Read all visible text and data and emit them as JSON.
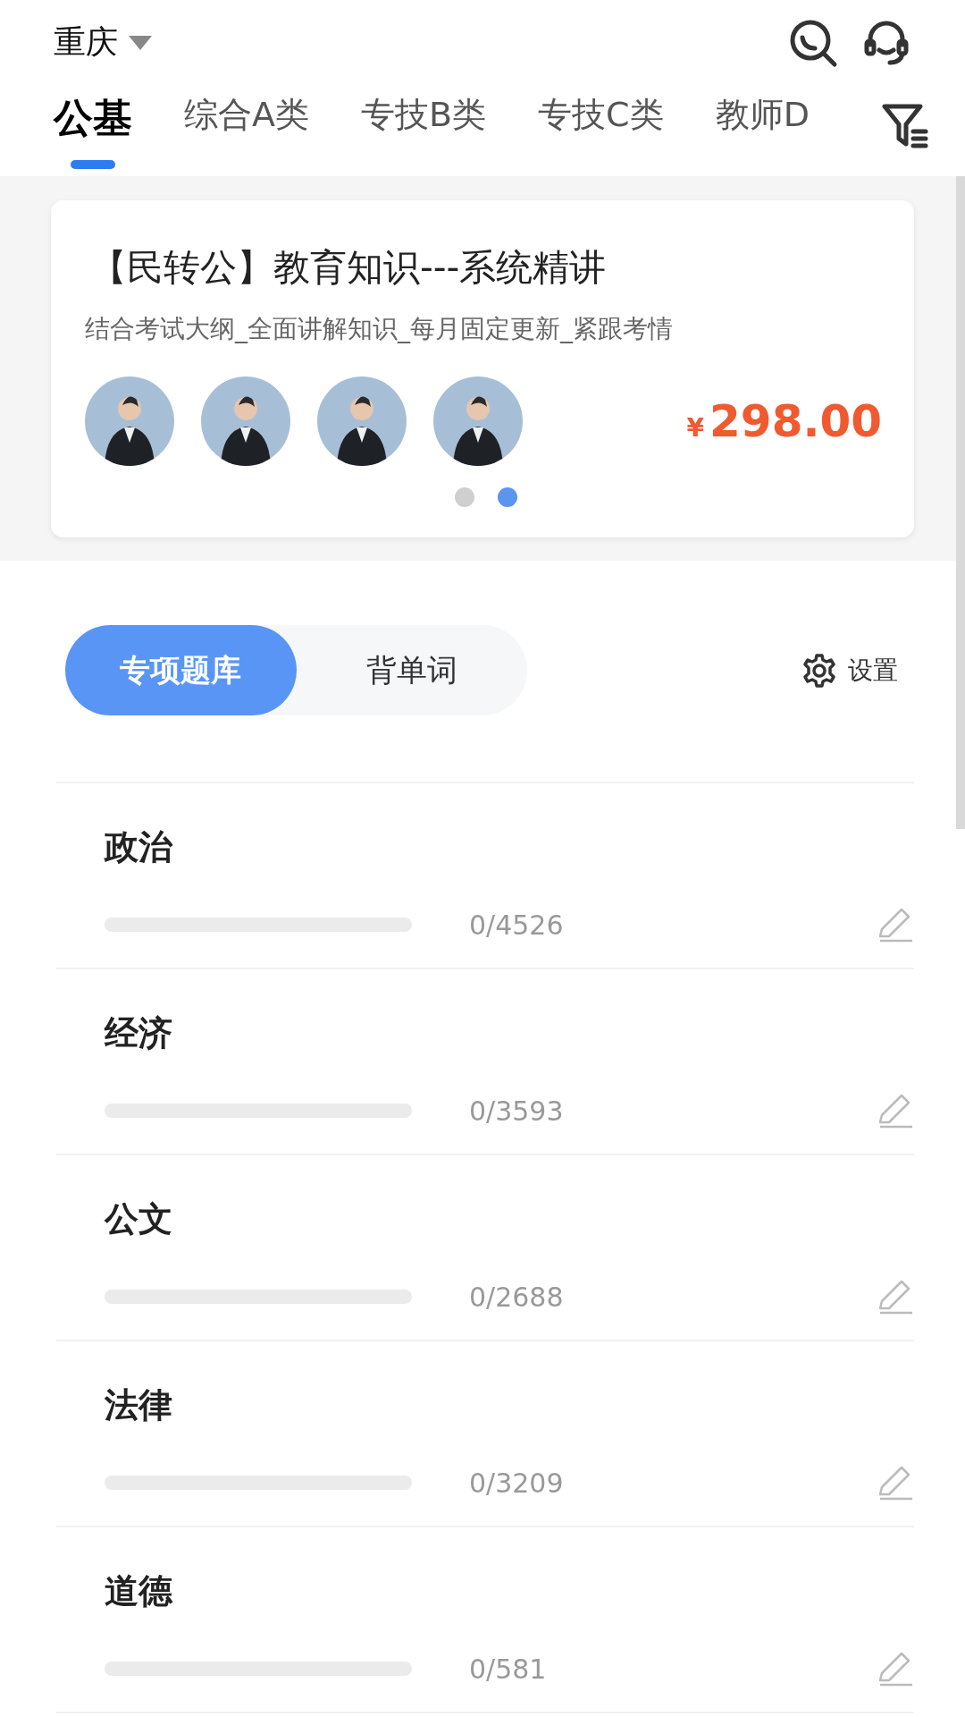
{
  "header": {
    "city": "重庆"
  },
  "tabs": [
    {
      "label": "公基",
      "selected": true
    },
    {
      "label": "综合A类",
      "selected": false
    },
    {
      "label": "专技B类",
      "selected": false
    },
    {
      "label": "专技C类",
      "selected": false
    },
    {
      "label": "教师D",
      "selected": false
    }
  ],
  "banner": {
    "title": "【民转公】教育知识---系统精讲",
    "subtitle": "结合考试大纲_全面讲解知识_每月固定更新_紧跟考情",
    "currency": "¥",
    "price": "298.00",
    "dots": [
      {
        "selected": false
      },
      {
        "selected": true
      }
    ]
  },
  "mode_switch": [
    {
      "label": "专项题库",
      "selected": true
    },
    {
      "label": "背单词",
      "selected": false
    }
  ],
  "settings": {
    "label": "设置"
  },
  "subjects": [
    {
      "name": "政治",
      "count": "0/4526"
    },
    {
      "name": "经济",
      "count": "0/3593"
    },
    {
      "name": "公文",
      "count": "0/2688"
    },
    {
      "name": "法律",
      "count": "0/3209"
    },
    {
      "name": "道德",
      "count": "0/581"
    }
  ]
}
